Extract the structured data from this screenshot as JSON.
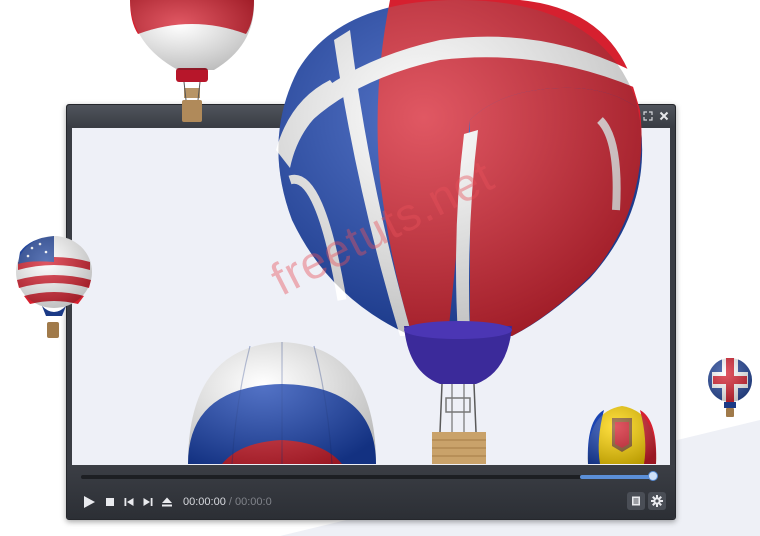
{
  "player": {
    "current_time": "00:00:00",
    "separator": "/",
    "duration": "00:00:0",
    "volume_level": 0.97
  },
  "icons": {
    "fullscreen": "fullscreen-icon",
    "close": "close-icon",
    "play": "play-icon",
    "stop": "stop-icon",
    "previous": "previous-icon",
    "next": "next-icon",
    "eject": "eject-icon",
    "playlist": "playlist-icon",
    "settings": "gear-icon"
  },
  "watermark": {
    "text": "freetuts.net"
  },
  "colors": {
    "accent": "#5b8fd8",
    "screen": "#eef0f7",
    "frame": "#3a3d44"
  }
}
